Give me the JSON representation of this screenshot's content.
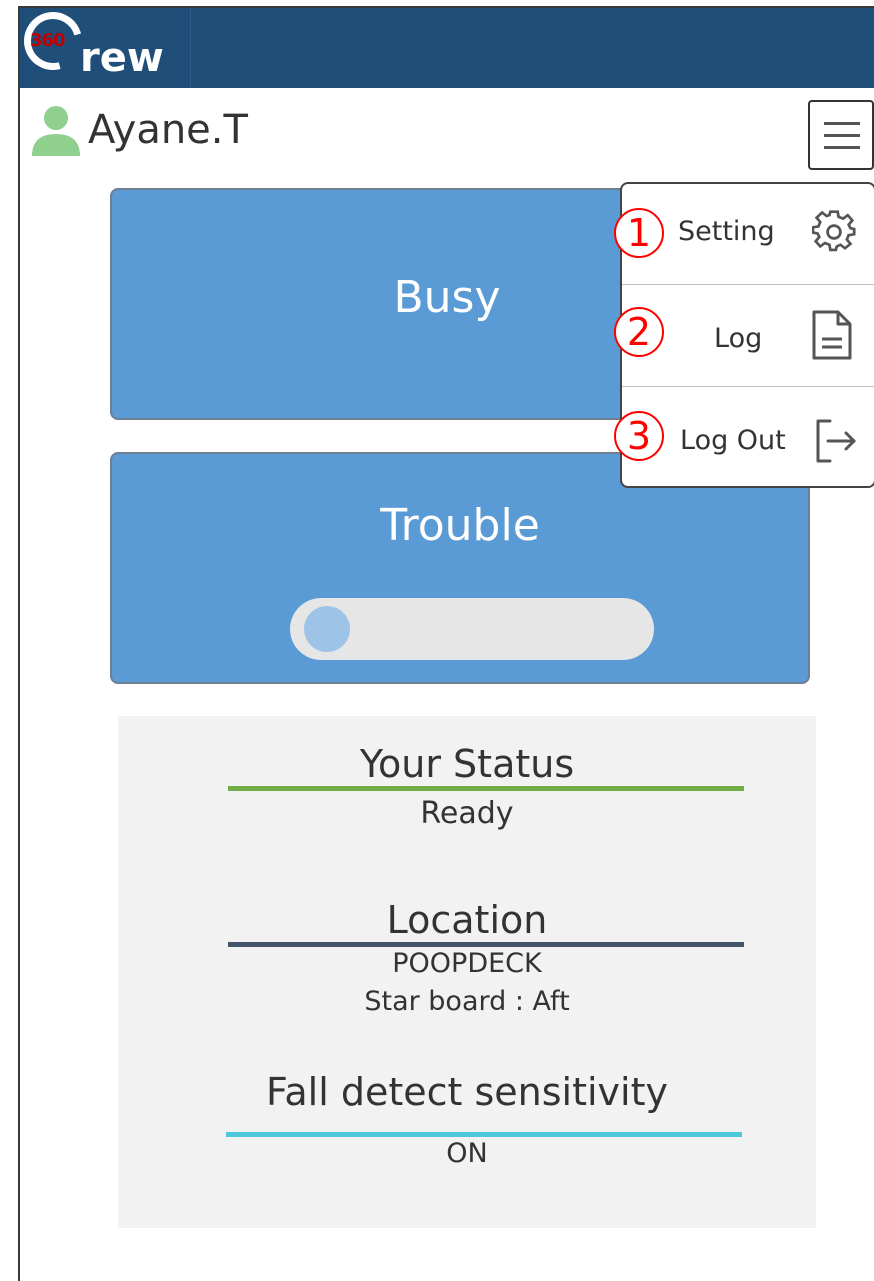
{
  "app": {
    "logo_number": "360",
    "logo_text": "rew",
    "header_color": "#1f4e79"
  },
  "user": {
    "name": "Ayane.T",
    "icon": "user-icon",
    "icon_color": "#8fd08f"
  },
  "menu": {
    "icon": "hamburger-icon",
    "items": [
      {
        "number": "1",
        "label": "Setting",
        "icon": "gear-icon"
      },
      {
        "number": "2",
        "label": "Log",
        "icon": "document-icon"
      },
      {
        "number": "3",
        "label": "Log Out",
        "icon": "logout-icon"
      }
    ],
    "number_color": "#ff0000"
  },
  "actions": {
    "busy_label": "Busy",
    "trouble_label": "Trouble",
    "trouble_toggle_on": false,
    "card_color": "#5b9bd5"
  },
  "status": {
    "your_status_heading": "Your Status",
    "your_status_value": "Ready",
    "your_status_color": "#70ad47",
    "location_heading": "Location",
    "location_area": "POOPDECK",
    "location_detail": "Star board : Aft",
    "location_color": "#44546a",
    "fall_heading": "Fall detect sensitivity",
    "fall_value": "ON",
    "fall_color": "#4dc9d9"
  }
}
